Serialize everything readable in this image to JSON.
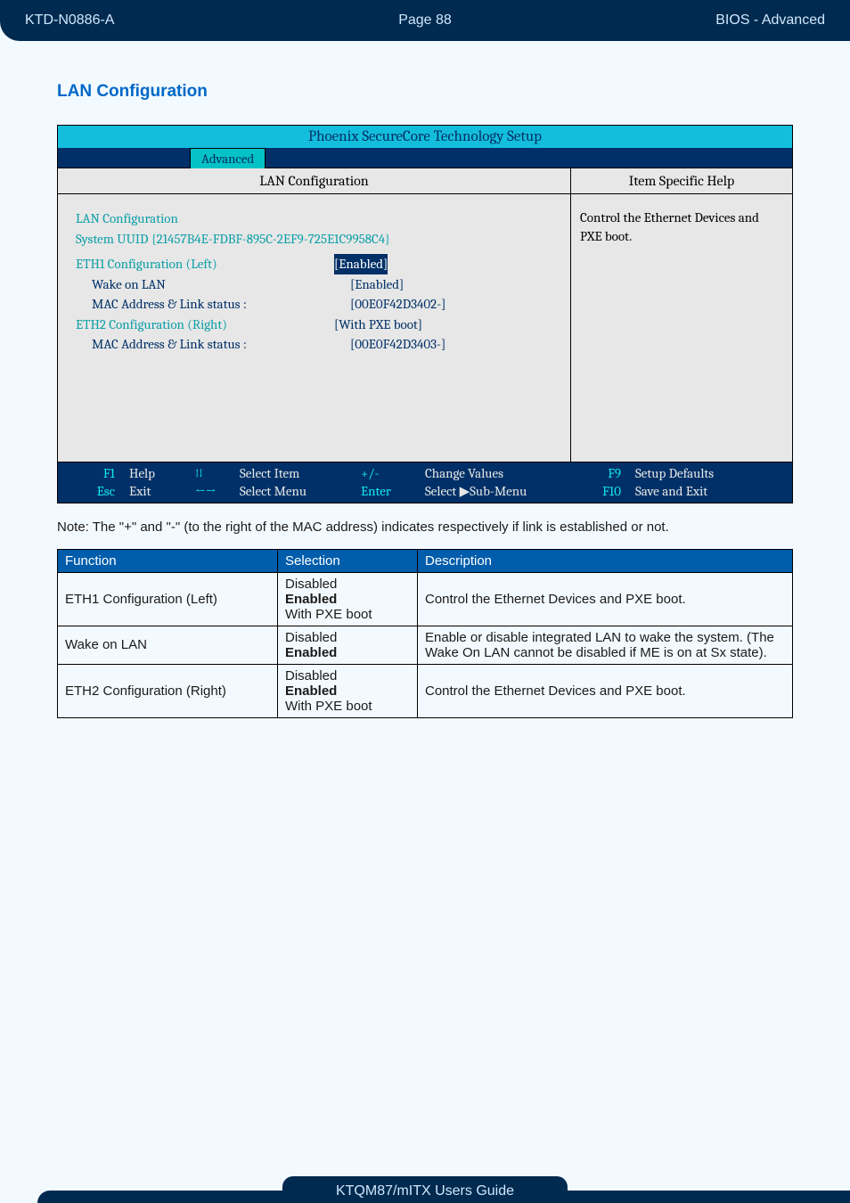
{
  "header": {
    "left": "KTD-N0886-A",
    "center": "Page 88",
    "right": "BIOS  - Advanced"
  },
  "section_title": "LAN Configuration",
  "bios": {
    "window_title": "Phoenix SecureCore Technology Setup",
    "active_tab": "Advanced",
    "main_header": "LAN Configuration",
    "help_header": "Item Specific Help",
    "help_text": "Control the Ethernet Devices and PXE boot.",
    "rows": {
      "lan_cfg": "LAN Configuration",
      "uuid_label": "System UUID {21457B4E-FDBF-895C-2EF9-725E1C9958C4}",
      "eth1_label": "ETH1 Configuration (Left)",
      "wake_label": "Wake on LAN",
      "wake_val": "[Enabled]",
      "mac1_label": "MAC Address & Link status :",
      "eth1_val": "[Enabled]",
      "mac1_val": "[00E0F42D3402-]",
      "eth2_label": "ETH2 Configuration (Right)",
      "eth2_val": "[With PXE boot]",
      "mac2_label": "MAC Address & Link status :",
      "mac2_val": "[00E0F42D3403-]"
    },
    "footer": {
      "k1": "F1",
      "k1t": "Help",
      "k2": "Esc",
      "k2t": "Exit",
      "arr1": "↑↓",
      "arr1t": "Select Item",
      "arr2": "←→",
      "arr2t": "Select Menu",
      "k3": "+/-",
      "k3t": "Change Values",
      "k4": "Enter",
      "k4t": "Select ▶Sub-Menu",
      "k5": "F9",
      "k5t": "Setup Defaults",
      "k6": "F10",
      "k6t": "Save and Exit"
    }
  },
  "note": "Note: The \"+\" and \"-\" (to the right of the MAC address) indicates respectively if link is established or not.",
  "table": {
    "headers": {
      "c1": "Function",
      "c2": "Selection",
      "c3": "Description"
    },
    "rows": [
      {
        "func": "ETH1 Configuration (Left)",
        "sel": [
          "Disabled",
          "Enabled",
          "With PXE boot"
        ],
        "sel_bold": 1,
        "desc": "Control the Ethernet Devices and PXE boot."
      },
      {
        "func": "Wake on LAN",
        "sel": [
          "Disabled",
          "Enabled"
        ],
        "sel_bold": 1,
        "desc": "Enable or disable integrated LAN to wake the system. (The Wake On LAN cannot be disabled if ME is on at Sx state)."
      },
      {
        "func": "ETH2 Configuration (Right)",
        "sel": [
          "Disabled",
          "Enabled",
          "With PXE boot"
        ],
        "sel_bold": 1,
        "desc": "Control the Ethernet Devices and PXE boot."
      }
    ]
  },
  "footer_tab": "KTQM87/mITX Users Guide"
}
